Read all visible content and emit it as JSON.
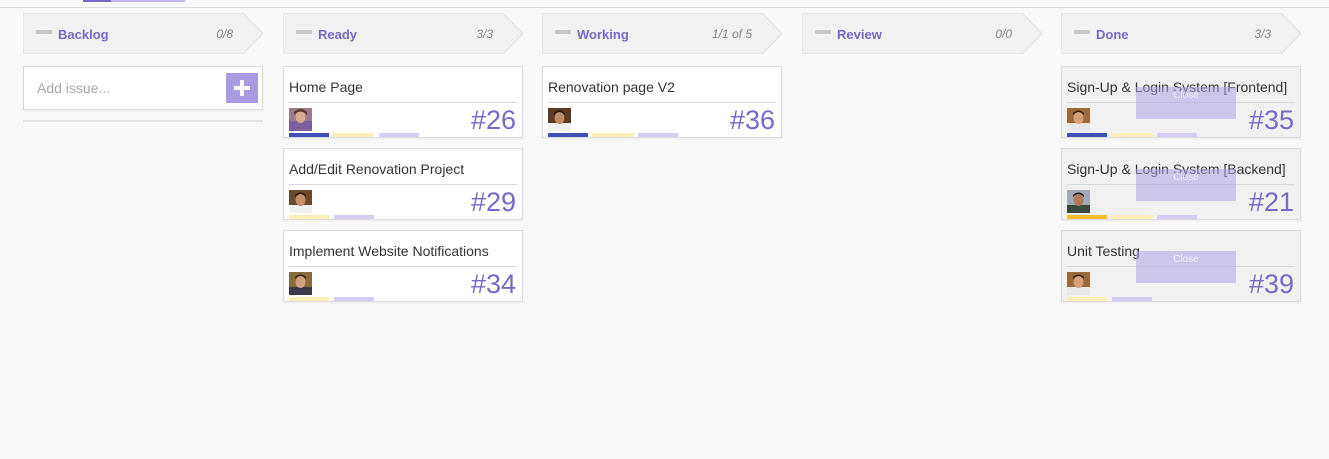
{
  "columns": [
    {
      "name": "Backlog",
      "count": "0/8",
      "add_placeholder": "Add issue..."
    },
    {
      "name": "Ready",
      "count": "3/3"
    },
    {
      "name": "Working",
      "count": "1/1 of 5"
    },
    {
      "name": "Review",
      "count": "0/0"
    },
    {
      "name": "Done",
      "count": "3/3"
    }
  ],
  "cards": {
    "home_page": {
      "title": "Home Page",
      "number": "#26"
    },
    "add_edit": {
      "title": "Add/Edit Renovation Project",
      "number": "#29"
    },
    "notifications": {
      "title": "Implement Website Notifications",
      "number": "#34"
    },
    "renovation_v2": {
      "title": "Renovation page V2",
      "number": "#36"
    },
    "signup_frontend": {
      "title": "Sign-Up & Login System [Frontend]",
      "number": "#35",
      "close_label": "Close"
    },
    "signup_backend": {
      "title": "Sign-Up & Login System [Backend]",
      "number": "#21",
      "close_label": "Close"
    },
    "unit_testing": {
      "title": "Unit Testing",
      "number": "#39",
      "close_label": "Close"
    }
  },
  "colors": {
    "accent": "#7a68c8",
    "bar_blue": "#3f51b5",
    "bar_gold": "#f0c030",
    "bar_yellow_light": "#fbeeb8",
    "bar_lavender": "#d7cdf2"
  }
}
